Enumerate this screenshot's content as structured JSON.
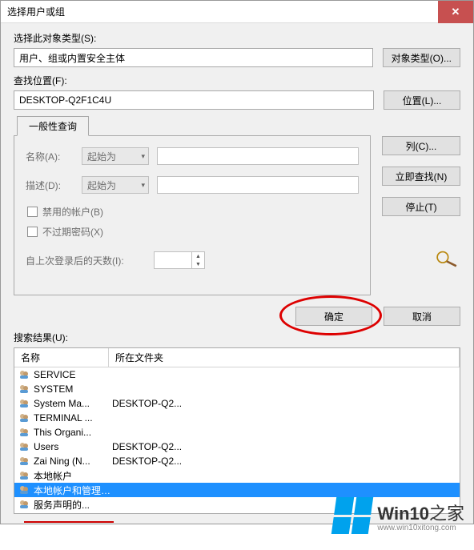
{
  "window": {
    "title": "选择用户或组"
  },
  "objectType": {
    "label": "选择此对象类型(S):",
    "value": "用户、组或内置安全主体",
    "button": "对象类型(O)..."
  },
  "location": {
    "label": "查找位置(F):",
    "value": "DESKTOP-Q2F1C4U",
    "button": "位置(L)..."
  },
  "tab": {
    "label": "一般性查询"
  },
  "query": {
    "name_label": "名称(A):",
    "name_match": "起始为",
    "desc_label": "描述(D):",
    "desc_match": "起始为",
    "disabled_chk": "禁用的帐户(B)",
    "nonexpire_chk": "不过期密码(X)",
    "lastlogin_label": "自上次登录后的天数(I):"
  },
  "side": {
    "columns": "列(C)...",
    "findnow": "立即查找(N)",
    "stop": "停止(T)"
  },
  "footer": {
    "ok": "确定",
    "cancel": "取消"
  },
  "results": {
    "label": "搜索结果(U):",
    "col_name": "名称",
    "col_folder": "所在文件夹",
    "rows": [
      {
        "name": "SERVICE",
        "folder": ""
      },
      {
        "name": "SYSTEM",
        "folder": ""
      },
      {
        "name": "System Ma...",
        "folder": "DESKTOP-Q2..."
      },
      {
        "name": "TERMINAL ...",
        "folder": ""
      },
      {
        "name": "This Organi...",
        "folder": ""
      },
      {
        "name": "Users",
        "folder": "DESKTOP-Q2..."
      },
      {
        "name": "Zai Ning (N...",
        "folder": "DESKTOP-Q2..."
      },
      {
        "name": "本地帐户",
        "folder": ""
      },
      {
        "name": "本地帐户和管理员组成员",
        "folder": "",
        "selected": true
      },
      {
        "name": "服务声明的...",
        "folder": ""
      }
    ]
  },
  "watermark": {
    "brand_a": "Win10",
    "brand_b": "之家",
    "url": "www.win10xitong.com"
  }
}
